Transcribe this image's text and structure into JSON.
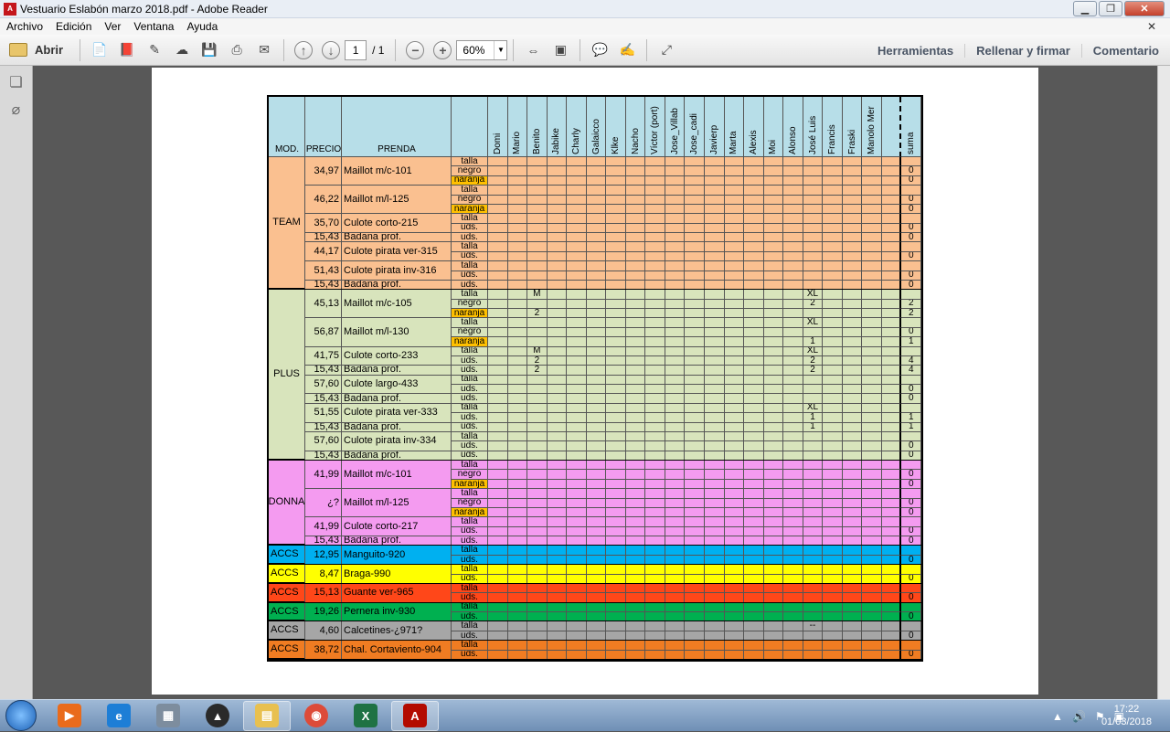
{
  "window": {
    "title": "Vestuario Eslabón marzo 2018.pdf - Adobe Reader"
  },
  "menu": [
    "Archivo",
    "Edición",
    "Ver",
    "Ventana",
    "Ayuda"
  ],
  "toolbar": {
    "open_label": "Abrir",
    "page_current": "1",
    "page_total": "/ 1",
    "zoom": "60%",
    "right": [
      "Herramientas",
      "Rellenar y firmar",
      "Comentario"
    ]
  },
  "sheet": {
    "headers": {
      "mod": "MOD.",
      "precio": "PRECIO",
      "prenda": "PRENDA"
    },
    "people": [
      "Domi",
      "Mario",
      "Benito",
      "Jabike",
      "Charly",
      "Galaicco",
      "Klke",
      "Nacho",
      "Víctor (port)",
      "Jose_Villab",
      "Jose_cadi",
      "Javierp",
      "Marta",
      "Alexis",
      "Moi",
      "Alonso",
      "José Luis",
      "Francis",
      "Fraski",
      "Manolo Mer",
      "",
      "suma"
    ],
    "groups": [
      {
        "name": "TEAM",
        "color": "#fac090",
        "products": [
          {
            "price": "34,97",
            "name": "Maillot m/c-101",
            "rows": [
              {
                "label": "talla",
                "suma": ""
              },
              {
                "label": "negro",
                "suma": "0"
              },
              {
                "label": "naranja",
                "suma": "0",
                "orange": true
              }
            ]
          },
          {
            "price": "46,22",
            "name": "Maillot m/l-125",
            "rows": [
              {
                "label": "talla",
                "suma": ""
              },
              {
                "label": "negro",
                "suma": "0"
              },
              {
                "label": "naranja",
                "suma": "0",
                "orange": true
              }
            ]
          },
          {
            "price": "35,70",
            "name": "Culote corto-215",
            "rows": [
              {
                "label": "talla",
                "suma": ""
              },
              {
                "label": "uds.",
                "suma": "0"
              }
            ]
          },
          {
            "price": "15,43",
            "name": "Badana prof.",
            "rows": [
              {
                "label": "uds.",
                "suma": "0"
              }
            ]
          },
          {
            "price": "44,17",
            "name": "Culote pirata ver-315",
            "rows": [
              {
                "label": "talla",
                "suma": ""
              },
              {
                "label": "uds.",
                "suma": "0"
              }
            ]
          },
          {
            "price": "51,43",
            "name": "Culote pirata inv-316",
            "rows": [
              {
                "label": "talla",
                "suma": ""
              },
              {
                "label": "uds.",
                "suma": "0"
              }
            ]
          },
          {
            "price": "15,43",
            "name": "Badana prof.",
            "rows": [
              {
                "label": "uds.",
                "suma": "0"
              }
            ]
          }
        ]
      },
      {
        "name": "PLUS",
        "color": "#d8e4bc",
        "products": [
          {
            "price": "45,13",
            "name": "Maillot m/c-105",
            "rows": [
              {
                "label": "talla",
                "suma": "",
                "vals": {
                  "2": "M",
                  "16": "XL"
                }
              },
              {
                "label": "negro",
                "suma": "2",
                "vals": {
                  "16": "2"
                }
              },
              {
                "label": "naranja",
                "suma": "2",
                "orange": true,
                "vals": {
                  "2": "2"
                }
              }
            ]
          },
          {
            "price": "56,87",
            "name": "Maillot m/l-130",
            "rows": [
              {
                "label": "talla",
                "suma": "",
                "vals": {
                  "16": "XL"
                }
              },
              {
                "label": "negro",
                "suma": "0"
              },
              {
                "label": "naranja",
                "suma": "1",
                "orange": true,
                "vals": {
                  "16": "1"
                }
              }
            ]
          },
          {
            "price": "41,75",
            "name": "Culote corto-233",
            "rows": [
              {
                "label": "talla",
                "suma": "",
                "vals": {
                  "2": "M",
                  "16": "XL"
                }
              },
              {
                "label": "uds.",
                "suma": "4",
                "vals": {
                  "2": "2",
                  "16": "2"
                }
              }
            ]
          },
          {
            "price": "15,43",
            "name": "Badana prof.",
            "rows": [
              {
                "label": "uds.",
                "suma": "4",
                "vals": {
                  "2": "2",
                  "16": "2"
                }
              }
            ]
          },
          {
            "price": "57,60",
            "name": "Culote largo-433",
            "rows": [
              {
                "label": "talla",
                "suma": ""
              },
              {
                "label": "uds.",
                "suma": "0"
              }
            ]
          },
          {
            "price": "15,43",
            "name": "Badana prof.",
            "rows": [
              {
                "label": "uds.",
                "suma": "0"
              }
            ]
          },
          {
            "price": "51,55",
            "name": "Culote pirata ver-333",
            "rows": [
              {
                "label": "talla",
                "suma": "",
                "vals": {
                  "16": "XL"
                }
              },
              {
                "label": "uds.",
                "suma": "1",
                "vals": {
                  "16": "1"
                }
              }
            ]
          },
          {
            "price": "15,43",
            "name": "Badana prof.",
            "rows": [
              {
                "label": "uds.",
                "suma": "1",
                "vals": {
                  "16": "1"
                }
              }
            ]
          },
          {
            "price": "57,60",
            "name": "Culote pirata inv-334",
            "rows": [
              {
                "label": "talla",
                "suma": ""
              },
              {
                "label": "uds.",
                "suma": "0"
              }
            ]
          },
          {
            "price": "15,43",
            "name": "Badana prof.",
            "rows": [
              {
                "label": "uds.",
                "suma": "0"
              }
            ]
          }
        ]
      },
      {
        "name": "DONNA",
        "color": "#f49bf0",
        "products": [
          {
            "price": "41,99",
            "name": "Maillot m/c-101",
            "rows": [
              {
                "label": "talla",
                "suma": ""
              },
              {
                "label": "negro",
                "suma": "0"
              },
              {
                "label": "naranja",
                "suma": "0",
                "orange": true
              }
            ]
          },
          {
            "price": "¿?",
            "name": "Maillot m/l-125",
            "rows": [
              {
                "label": "talla",
                "suma": ""
              },
              {
                "label": "negro",
                "suma": "0"
              },
              {
                "label": "naranja",
                "suma": "0",
                "orange": true
              }
            ]
          },
          {
            "price": "41,99",
            "name": "Culote corto-217",
            "rows": [
              {
                "label": "talla",
                "suma": ""
              },
              {
                "label": "uds.",
                "suma": "0"
              }
            ]
          },
          {
            "price": "15,43",
            "name": "Badana prof.",
            "rows": [
              {
                "label": "uds.",
                "suma": "0"
              }
            ]
          }
        ]
      },
      {
        "name": "ACCS",
        "color": "#00b0f0",
        "products": [
          {
            "price": "12,95",
            "name": "Manguito-920",
            "rows": [
              {
                "label": "talla",
                "suma": ""
              },
              {
                "label": "uds.",
                "suma": "0"
              }
            ]
          }
        ]
      },
      {
        "name": "ACCS",
        "color": "#ffff00",
        "products": [
          {
            "price": "8,47",
            "name": "Braga-990",
            "rows": [
              {
                "label": "talla",
                "suma": ""
              },
              {
                "label": "uds.",
                "suma": "0"
              }
            ]
          }
        ]
      },
      {
        "name": "ACCS",
        "color": "#ff4719",
        "products": [
          {
            "price": "15,13",
            "name": "Guante ver-965",
            "rows": [
              {
                "label": "talla",
                "suma": ""
              },
              {
                "label": "uds.",
                "suma": "0"
              }
            ]
          }
        ]
      },
      {
        "name": "ACCS",
        "color": "#00b050",
        "products": [
          {
            "price": "19,26",
            "name": "Pernera inv-930",
            "rows": [
              {
                "label": "talla",
                "suma": ""
              },
              {
                "label": "uds.",
                "suma": "0"
              }
            ]
          }
        ]
      },
      {
        "name": "ACCS",
        "color": "#a6a6a6",
        "products": [
          {
            "price": "4,60",
            "name": "Calcetines-¿971?",
            "rows": [
              {
                "label": "talla",
                "suma": "",
                "vals": {
                  "16": "--"
                }
              },
              {
                "label": "uds.",
                "suma": "0"
              }
            ]
          }
        ]
      },
      {
        "name": "ACCS",
        "color": "#f07c22",
        "products": [
          {
            "price": "38,72",
            "name": "Chal. Cortaviento-904",
            "rows": [
              {
                "label": "talla",
                "suma": ""
              },
              {
                "label": "uds.",
                "suma": "0"
              }
            ]
          }
        ]
      }
    ]
  },
  "taskbar": {
    "time": "17:22",
    "date": "01/03/2018"
  }
}
